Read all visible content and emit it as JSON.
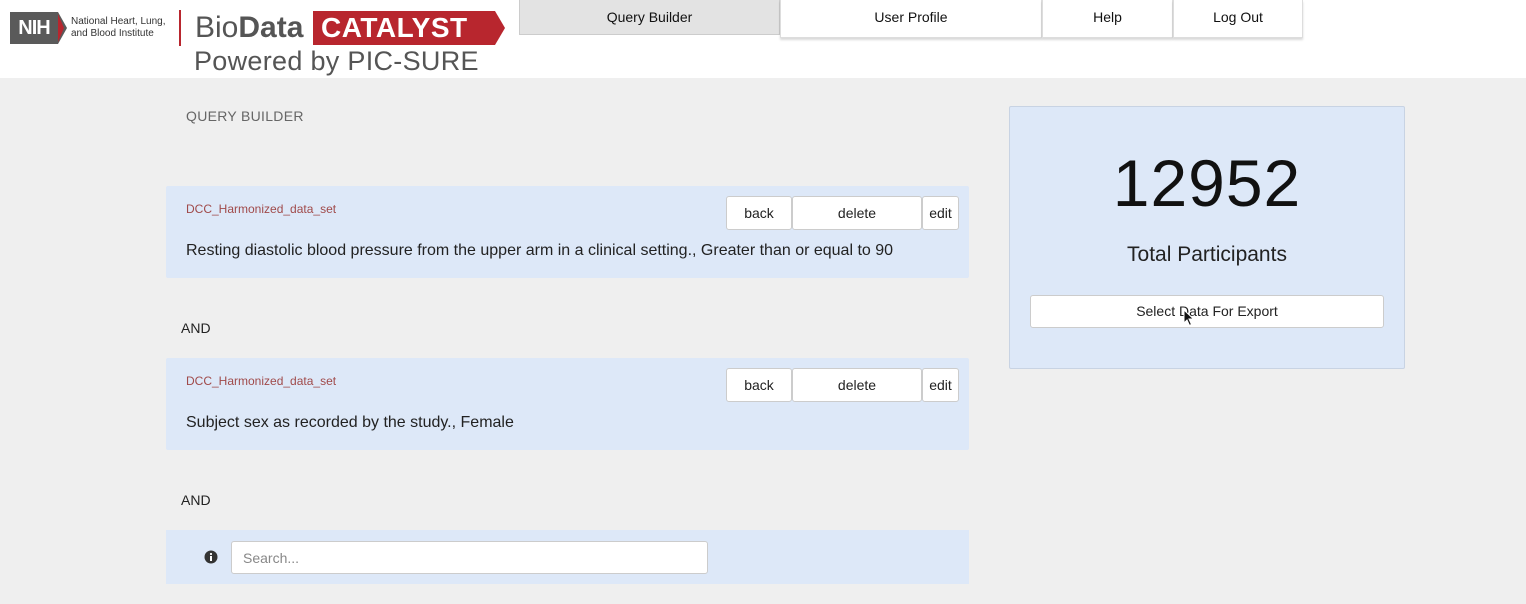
{
  "header": {
    "nih_logo": "NIH",
    "nih_name": "National Heart, Lung, and Blood Institute",
    "brand_bio": "Bio",
    "brand_data": "Data",
    "brand_catalyst": "CATALYST",
    "powered_by": "Powered by PIC-SURE"
  },
  "nav": {
    "tabs": [
      {
        "label": "Query Builder",
        "active": true
      },
      {
        "label": "User Profile",
        "active": false
      },
      {
        "label": "Help",
        "active": false
      },
      {
        "label": "Log Out",
        "active": false
      }
    ]
  },
  "query": {
    "section_title": "QUERY BUILDER",
    "and_label": "AND",
    "filters": [
      {
        "source": "DCC_Harmonized_data_set",
        "description": "Resting diastolic blood pressure from the upper arm in a clinical setting., Greater than or equal to 90",
        "back_label": "back",
        "delete_label": "delete",
        "edit_label": "edit"
      },
      {
        "source": "DCC_Harmonized_data_set",
        "description": "Subject sex as recorded by the study., Female",
        "back_label": "back",
        "delete_label": "delete",
        "edit_label": "edit"
      }
    ],
    "search": {
      "placeholder": "Search...",
      "value": "",
      "icon": "info-icon"
    }
  },
  "results": {
    "count": "12952",
    "count_label": "Total Participants",
    "export_button": "Select Data For Export"
  },
  "colors": {
    "brand_red": "#b8262e",
    "card_background": "#dde8f8",
    "page_background": "#efefef",
    "source_text": "#a04a4a"
  }
}
